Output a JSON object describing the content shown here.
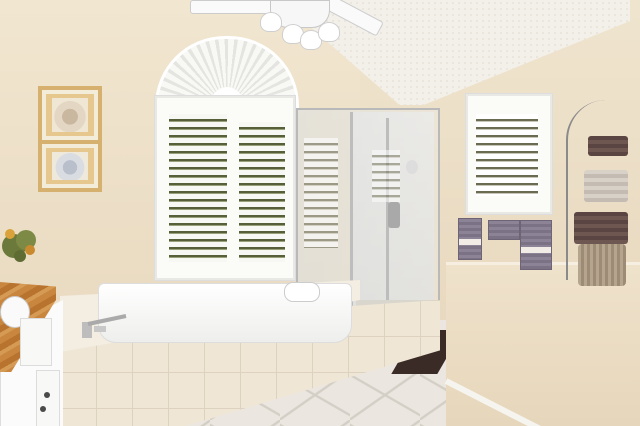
{
  "scene": {
    "alt": "",
    "elements": [
      "ceiling-fan",
      "arched-window",
      "plantation-shutters",
      "glass-shower",
      "soaking-tub",
      "tile-floor",
      "towels",
      "wall-art",
      "vanity"
    ]
  },
  "colors": {
    "wall": "#efe4ce",
    "ceiling": "#f3f0ea",
    "tile": "#efe6d6",
    "floor": "#ebe6df",
    "counter": "#c9863f",
    "towel": "#8d8396",
    "rug": "#3b2b26",
    "frame": "#d6b06f"
  }
}
